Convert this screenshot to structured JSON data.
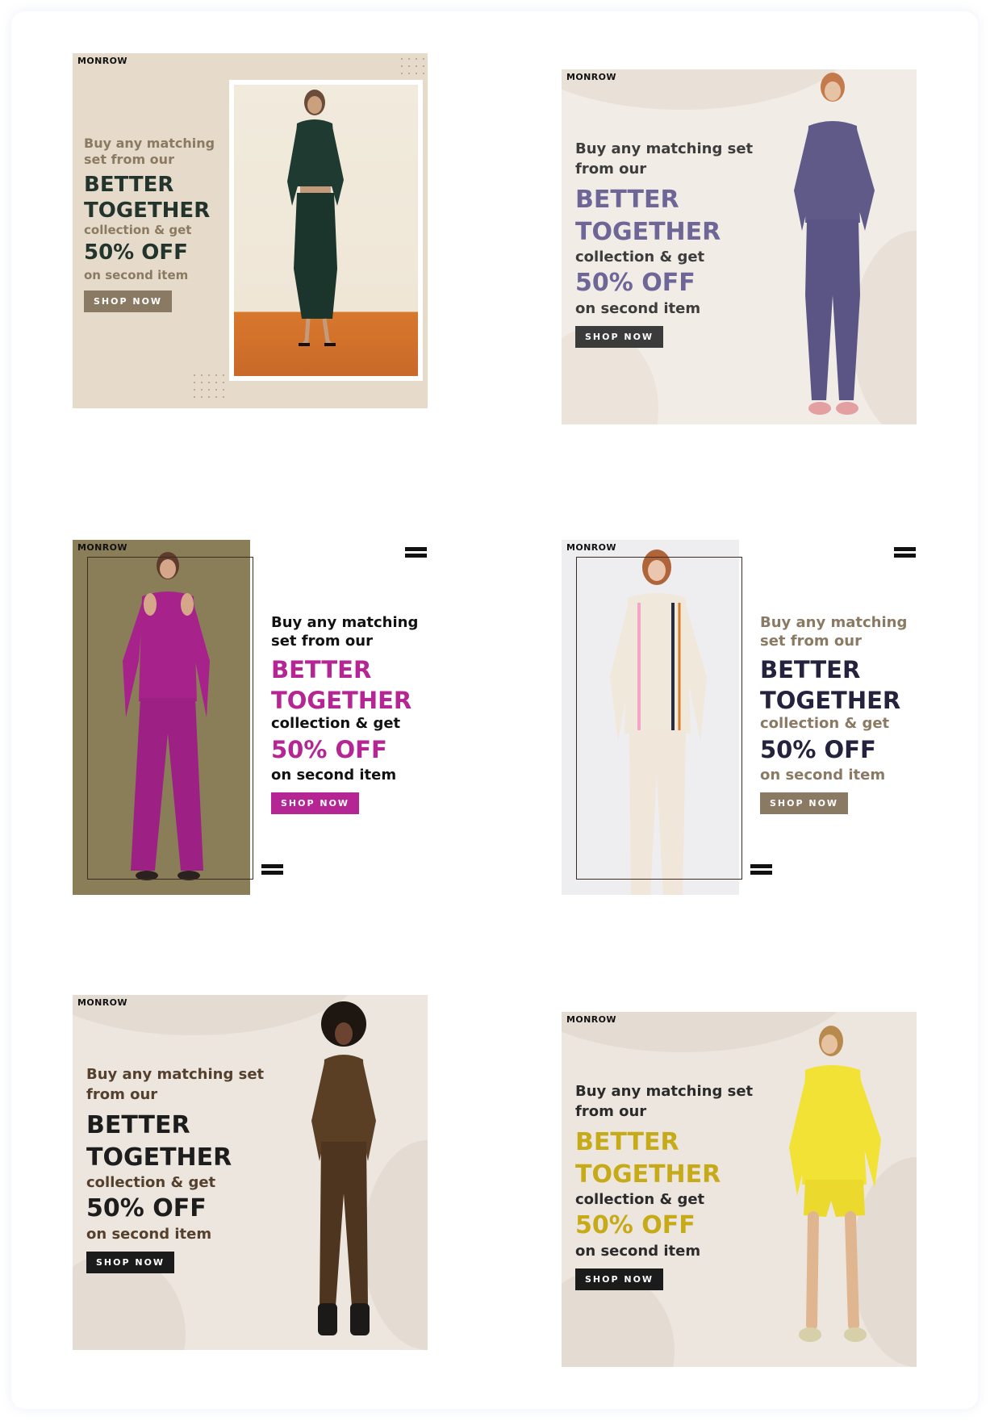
{
  "brand": "MONROW",
  "promo": {
    "intro_a": "Buy any matching",
    "intro_b_short": "set from our",
    "intro_a_long": "Buy any matching set",
    "intro_b_long": "from our",
    "better": "BETTER",
    "together": "TOGETHER",
    "collection": "collection & get",
    "discount": "50% OFF",
    "second": "on second item",
    "cta": "SHOP NOW"
  },
  "ads": [
    {
      "id": 1,
      "outfit": "dark green knit top and midi skirt",
      "accent": "#23342d",
      "intro_color": "#8a7a62",
      "button_color": "#8b7a63",
      "background": "#e6dbca"
    },
    {
      "id": 2,
      "outfit": "purple sweatshirt and joggers",
      "accent": "#6f6698",
      "intro_color": "#3d3d3d",
      "button_color": "#3b3b3b",
      "background": "#f2ece6"
    },
    {
      "id": 3,
      "outfit": "magenta cold-shoulder knit set",
      "accent": "#b52593",
      "intro_color": "#111111",
      "button_color": "#b52593",
      "background": "#ffffff"
    },
    {
      "id": 4,
      "outfit": "cream cardigan set with stripes",
      "accent": "#24223d",
      "intro_color": "#8b7a63",
      "button_color": "#8b7a63",
      "background": "#ffffff"
    },
    {
      "id": 5,
      "outfit": "brown ribbed knit set",
      "accent": "#1d1d1d",
      "intro_color": "#55402e",
      "button_color": "#1b1b1b",
      "background": "#ece6df"
    },
    {
      "id": 6,
      "outfit": "yellow shirt and shorts set",
      "accent": "#c6aa17",
      "intro_color": "#2b2b2b",
      "button_color": "#1b1b1b",
      "background": "#ece6df"
    }
  ]
}
